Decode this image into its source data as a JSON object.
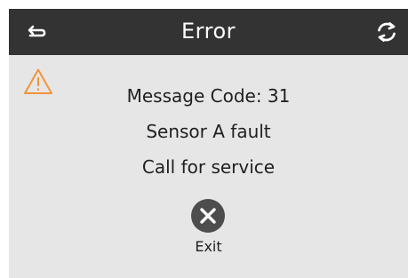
{
  "header": {
    "title": "Error",
    "back_icon": "return-arrow-icon",
    "refresh_icon": "refresh-icon"
  },
  "alert": {
    "icon": "warning-triangle-icon",
    "message_code": "Message Code: 31",
    "fault": "Sensor A fault",
    "instruction": "Call for service"
  },
  "exit": {
    "icon": "close-circle-icon",
    "label": "Exit"
  },
  "colors": {
    "header_bg": "#333333",
    "screen_bg": "#e6e6e6",
    "warning": "#f0953a",
    "exit_button": "#4d4d4d"
  }
}
